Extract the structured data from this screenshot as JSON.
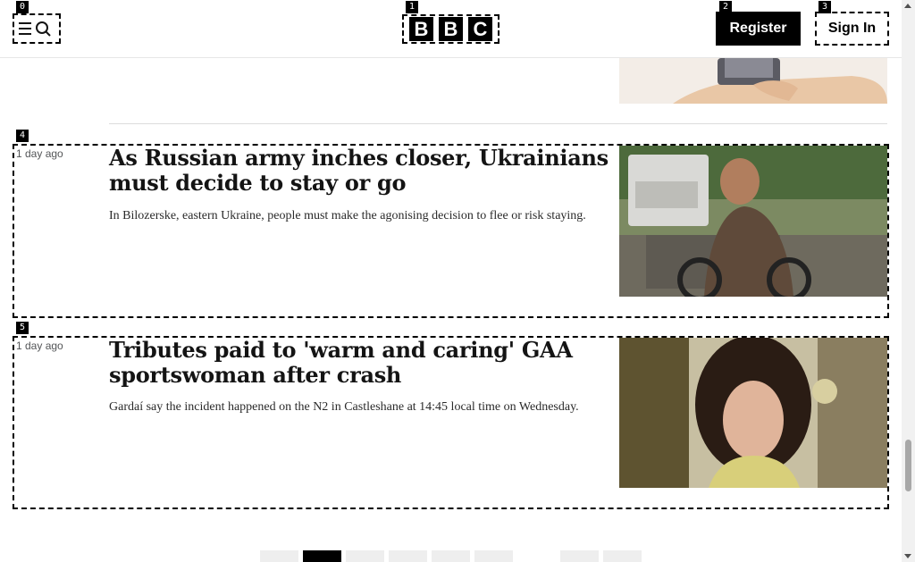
{
  "header": {
    "logo_letters": [
      "B",
      "B",
      "C"
    ],
    "register_label": "Register",
    "signin_label": "Sign In",
    "menu_icons": [
      "menu-icon",
      "search-icon"
    ]
  },
  "tags": [
    "0",
    "1",
    "2",
    "3",
    "4",
    "5"
  ],
  "articles": [
    {
      "time": "1 day ago",
      "headline": "As Russian army inches closer, Ukrainians must decide to stay or go",
      "summary": "In Bilozerske, eastern Ukraine, people must make the agonising decision to flee or risk staying."
    },
    {
      "time": "1 day ago",
      "headline": "Tributes paid to 'warm and caring' GAA sportswoman after crash",
      "summary": "Gardaí say the incident happened on the N2 in Castleshane at 14:45 local time on Wednesday."
    }
  ],
  "pagination": {
    "active_index": 1
  },
  "colors": {
    "accent": "#000000",
    "text": "#141414",
    "muted": "#545658"
  }
}
